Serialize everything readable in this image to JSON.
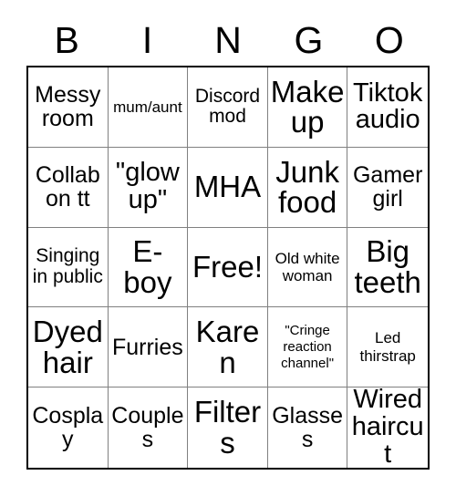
{
  "card": {
    "title": "BINGO",
    "header_letters": [
      "B",
      "I",
      "N",
      "G",
      "O"
    ],
    "colors": {
      "background": "#ffffff",
      "text": "#000000",
      "outer_border": "#000000",
      "grid_line": "#808080"
    },
    "grid_size": "5x5",
    "free_space": "Free!",
    "rows": [
      [
        {
          "label": "Messy room",
          "size": "lg"
        },
        {
          "label": "mum/aunt",
          "size": "sm"
        },
        {
          "label": "Discord mod",
          "size": "md"
        },
        {
          "label": "Make up",
          "size": "xxl"
        },
        {
          "label": "Tiktok audio",
          "size": "xl"
        }
      ],
      [
        {
          "label": "Collab on tt",
          "size": "lg"
        },
        {
          "label": "\"glow up\"",
          "size": "xl"
        },
        {
          "label": "MHA",
          "size": "xxl"
        },
        {
          "label": "Junk food",
          "size": "xxl"
        },
        {
          "label": "Gamer girl",
          "size": "lg"
        }
      ],
      [
        {
          "label": "Singing in public",
          "size": "md"
        },
        {
          "label": "E-boy",
          "size": "xxl"
        },
        {
          "label": "Free!",
          "size": "xxl"
        },
        {
          "label": "Old white woman",
          "size": "sm"
        },
        {
          "label": "Big teeth",
          "size": "xxl"
        }
      ],
      [
        {
          "label": "Dyed hair",
          "size": "xxl"
        },
        {
          "label": "Furries",
          "size": "lg"
        },
        {
          "label": "Karen",
          "size": "xxl"
        },
        {
          "label": "\"Cringe reaction channel\"",
          "size": "xs"
        },
        {
          "label": "Led thirstrap",
          "size": "sm"
        }
      ],
      [
        {
          "label": "Cosplay",
          "size": "lg"
        },
        {
          "label": "Couples",
          "size": "lg"
        },
        {
          "label": "Filters",
          "size": "xxl"
        },
        {
          "label": "Glasses",
          "size": "lg"
        },
        {
          "label": "Wired haircut",
          "size": "xl"
        }
      ]
    ]
  }
}
